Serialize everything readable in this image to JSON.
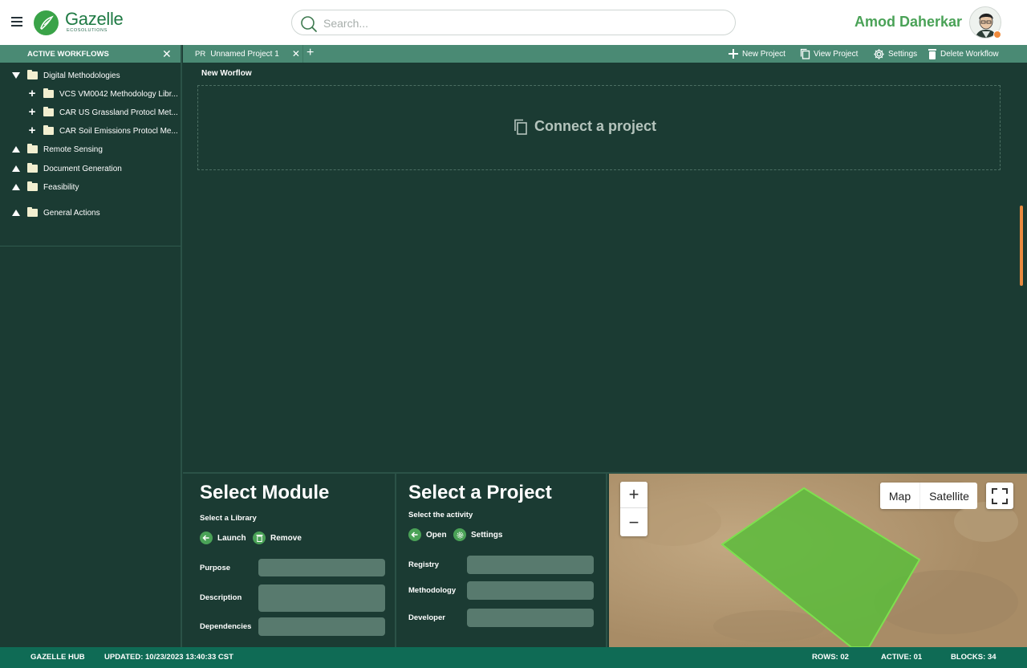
{
  "header": {
    "brand_name": "Gazelle",
    "brand_sub": "ECOSOLUTIONS",
    "search_placeholder": "Search...",
    "user_name": "Amod Daherkar"
  },
  "sidebar": {
    "title": "ACTIVE WORKFLOWS",
    "items": [
      {
        "label": "Digital Methodologies"
      },
      {
        "label": "VCS VM0042 Methodology Libr..."
      },
      {
        "label": "CAR US Grassland Protocl Met..."
      },
      {
        "label": "CAR Soil Emissions Protocl Me..."
      },
      {
        "label": "Remote Sensing"
      },
      {
        "label": "Document Generation"
      },
      {
        "label": "Feasibility"
      },
      {
        "label": "General Actions"
      }
    ]
  },
  "tabs": [
    {
      "prefix": "PR",
      "label": "Unnamed Project 1"
    }
  ],
  "toolbar": {
    "new_project": "New Project",
    "view_project": "View Project",
    "settings": "Settings",
    "delete_workflow": "Delete Workflow"
  },
  "workflow": {
    "label": "New Worflow",
    "connect_text": "Connect a project"
  },
  "module_panel": {
    "title": "Select Module",
    "subtitle": "Select a Library",
    "launch": "Launch",
    "remove": "Remove",
    "fields": [
      "Purpose",
      "Description",
      "Dependencies"
    ]
  },
  "project_panel": {
    "title": "Select a Project",
    "subtitle": "Select the activity",
    "open": "Open",
    "settings": "Settings",
    "fields": [
      "Registry",
      "Methodology",
      "Developer"
    ]
  },
  "map": {
    "zoom_in": "+",
    "zoom_out": "−",
    "type_map": "Map",
    "type_satellite": "Satellite"
  },
  "footer": {
    "hub": "GAZELLE HUB",
    "updated": "UPDATED: 10/23/2023 13:40:33 CST",
    "rows": "ROWS: 02",
    "active": "ACTIVE: 01",
    "blocks": "BLOCKS: 34"
  },
  "colors": {
    "background": "#1b3b33",
    "bar": "#4a8a74",
    "brand_green": "#3aa348",
    "footer": "#0f6b55",
    "accent_orange": "#e98a3f",
    "field": "#587a6e"
  },
  "icons": [
    "menu-icon",
    "search-icon",
    "close-icon",
    "plus-icon",
    "folder-icon",
    "caret-icon",
    "settings-gear-icon",
    "trash-icon",
    "copy-icon",
    "fullscreen-icon"
  ]
}
